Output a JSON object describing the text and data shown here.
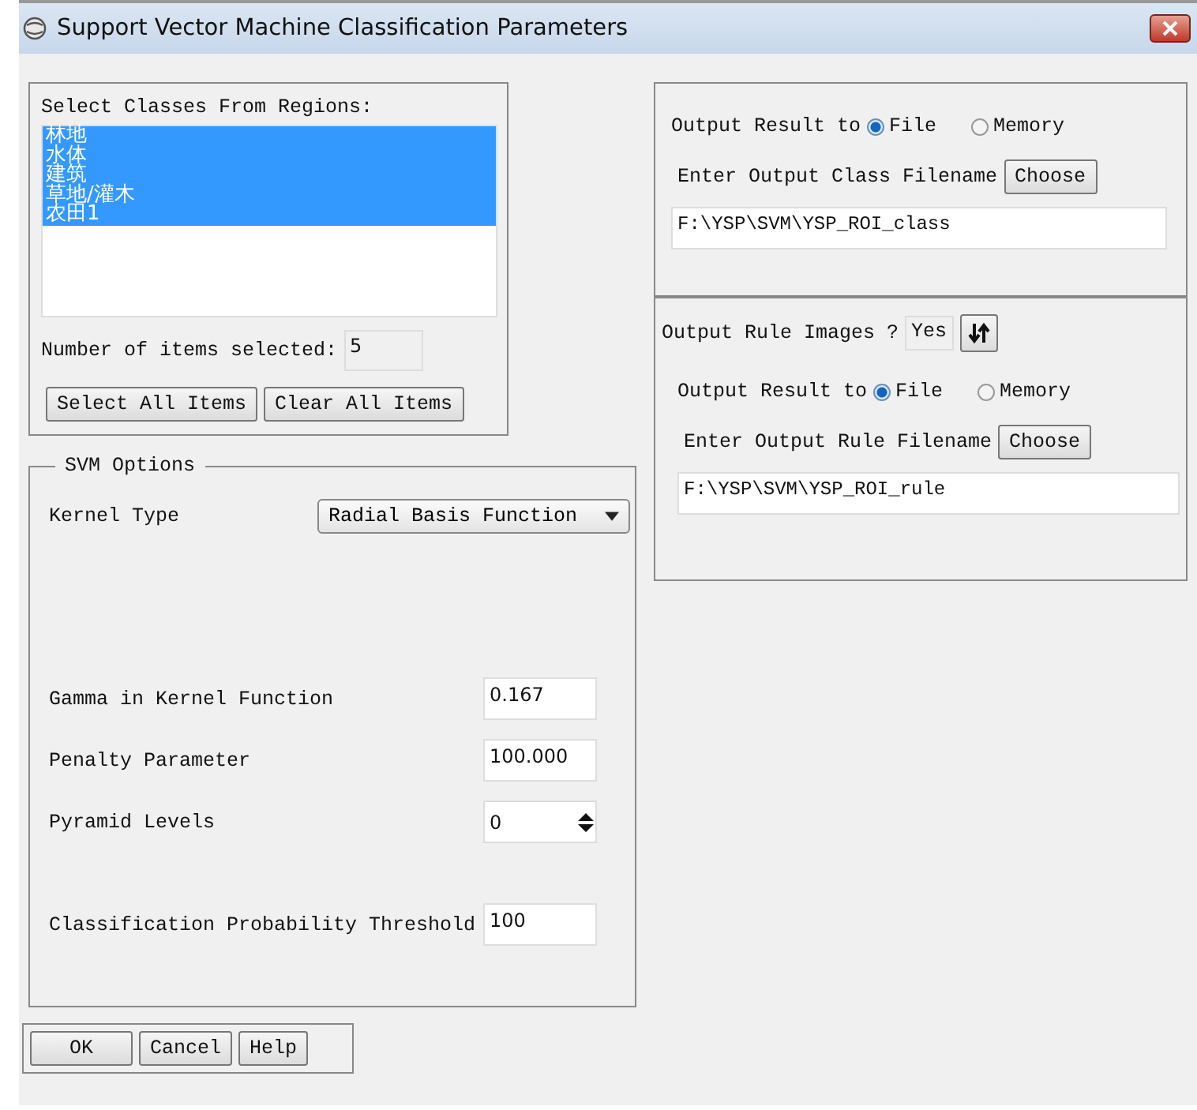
{
  "window": {
    "title": "Support Vector Machine Classification Parameters"
  },
  "class_list": {
    "label": "Select Classes From Regions:",
    "items": [
      {
        "label": "林地",
        "selected": true
      },
      {
        "label": "水体",
        "selected": true
      },
      {
        "label": "建筑",
        "selected": true
      },
      {
        "label": "草地/灌木",
        "selected": true
      },
      {
        "label": "农田1",
        "selected": true
      }
    ],
    "count_label": "Number of items selected:",
    "count": "5",
    "buttons": [
      "Select All Items",
      "Clear All Items"
    ]
  },
  "svm_options": {
    "title": "SVM Options",
    "kernel": {
      "label": "Kernel Type",
      "value": "Radial Basis Function"
    },
    "fields": [
      {
        "label": "Gamma in Kernel Function",
        "value": "0.167",
        "kind": "text"
      },
      {
        "label": "Penalty Parameter",
        "value": "100.000",
        "kind": "text"
      },
      {
        "label": "Pyramid Levels",
        "value": "0",
        "kind": "spinner"
      },
      {
        "label": "Classification Probability Threshold",
        "value": "100",
        "kind": "text"
      }
    ]
  },
  "output_class": {
    "label": "Output Result to",
    "options": [
      {
        "label": "File",
        "selected": true
      },
      {
        "label": "Memory",
        "selected": false
      }
    ],
    "filename_label": "Enter Output Class Filename",
    "choose": "Choose",
    "filename": "F:\\YSP\\SVM\\YSP_ROI_class"
  },
  "rule_images": {
    "label": "Output Rule Images ?",
    "value": "Yes",
    "output_label": "Output Result to",
    "options": [
      {
        "label": "File",
        "selected": true
      },
      {
        "label": "Memory",
        "selected": false
      }
    ],
    "filename_label": "Enter Output Rule Filename",
    "choose": "Choose",
    "filename": "F:\\YSP\\SVM\\YSP_ROI_rule"
  },
  "buttons": [
    "OK",
    "Cancel",
    "Help"
  ]
}
